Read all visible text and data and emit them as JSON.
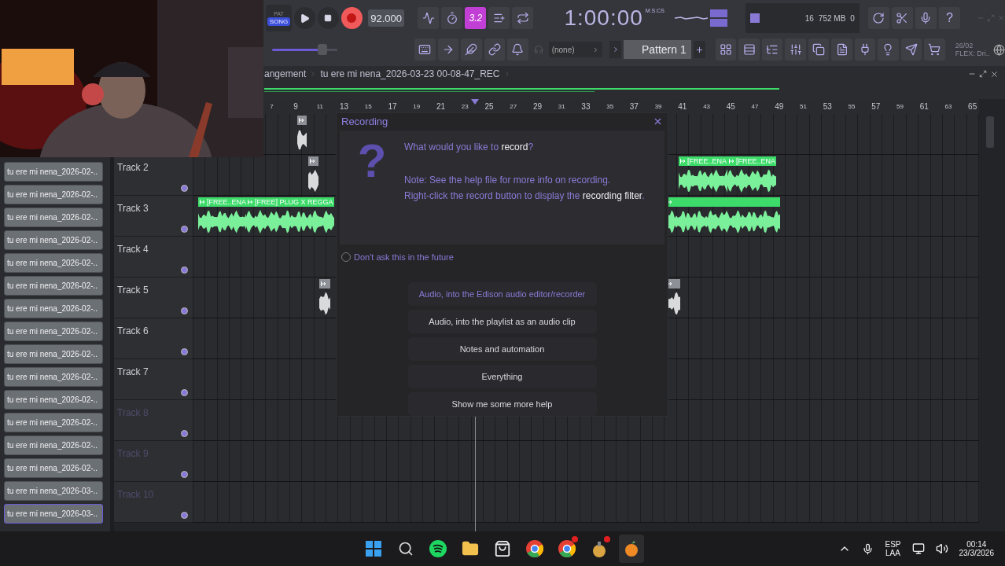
{
  "toolbar": {
    "mode_top": "PAT",
    "mode": "SONG",
    "song_mode": true,
    "tempo": "92.000",
    "snap": "3.2",
    "time": "1:00:00",
    "time_unit": "M:S:CS",
    "cpu": "16",
    "memory": "752 MB",
    "polyphony": "0",
    "help": "?",
    "master_volume": {
      "level": 0.77
    },
    "channel_select": "(none)",
    "pattern": "Pattern 1",
    "info": [
      "26/02",
      "FLEX: Dri.."
    ]
  },
  "breadcrumb": [
    "angement",
    "tu ere mi nena_2026-03-23 00-08-47_REC"
  ],
  "browser": [
    {
      "label": "tu ere mi nena_2026-02-..",
      "selected": false
    },
    {
      "label": "tu ere mi nena_2026-02-..",
      "selected": false
    },
    {
      "label": "tu ere mi nena_2026-02-..",
      "selected": false
    },
    {
      "label": "tu ere mi nena_2026-02-..",
      "selected": false
    },
    {
      "label": "tu ere mi nena_2026-02-..",
      "selected": false
    },
    {
      "label": "tu ere mi nena_2026-02-..",
      "selected": false
    },
    {
      "label": "tu ere mi nena_2026-02-..",
      "selected": false
    },
    {
      "label": "tu ere mi nena_2026-02-..",
      "selected": false
    },
    {
      "label": "tu ere mi nena_2026-02-..",
      "selected": false
    },
    {
      "label": "tu ere mi nena_2026-02-..",
      "selected": false
    },
    {
      "label": "tu ere mi nena_2026-02-..",
      "selected": false
    },
    {
      "label": "tu ere mi nena_2026-02-..",
      "selected": false
    },
    {
      "label": "tu ere mi nena_2026-02-..",
      "selected": false
    },
    {
      "label": "tu ere mi nena_2026-02-..",
      "selected": false
    },
    {
      "label": "tu ere mi nena_2026-03-..",
      "selected": false
    },
    {
      "label": "tu ere mi nena_2026-03-..",
      "selected": true
    }
  ],
  "ruler": [
    "7",
    "9",
    "11",
    "13",
    "15",
    "17",
    "19",
    "21",
    "23",
    "25",
    "27",
    "29",
    "31",
    "33",
    "35",
    "37",
    "39",
    "41",
    "43",
    "45",
    "47",
    "49",
    "51",
    "53",
    "55",
    "57",
    "59",
    "61",
    "63",
    "65"
  ],
  "tracks": [
    {
      "clips": [
        {
          "color": "#8d9197"
        }
      ]
    },
    {
      "name": "Track 2",
      "enabled": true,
      "clips": [
        {
          "color": "#8d9197"
        },
        {
          "color": "#3ddc6a",
          "label": "[FREE..ENA"
        },
        {
          "color": "#3ddc6a",
          "label": "[FREE..ENA"
        }
      ]
    },
    {
      "name": "Track 3",
      "enabled": true,
      "clips": [
        {
          "color": "#3ddc6a",
          "label": "[FREE..ENA"
        },
        {
          "color": "#3ddc6a",
          "label": "[FREE] PLUG X REGGA"
        },
        {
          "color": "#3ddc6a"
        }
      ]
    },
    {
      "name": "Track 4",
      "enabled": true
    },
    {
      "name": "Track 5",
      "enabled": true,
      "clips": [
        {
          "color": "#8d9197"
        },
        {
          "color": "#8d9197"
        }
      ]
    },
    {
      "name": "Track 6",
      "enabled": true
    },
    {
      "name": "Track 7",
      "enabled": true
    },
    {
      "name": "Track 8",
      "enabled": false
    },
    {
      "name": "Track 9",
      "enabled": false
    },
    {
      "name": "Track 10",
      "enabled": false
    }
  ],
  "dialog": {
    "title": "Recording",
    "icon": "?",
    "question": "What would you like to **record**?",
    "note": "Note: See the help file for more info on recording.",
    "hint": "Right-click the record button to display the **recording filter**.",
    "checkbox": {
      "label": "Don't ask this in the future",
      "checked": false
    },
    "options": [
      {
        "label": "Audio, into the Edison audio editor/recorder",
        "selected": true
      },
      {
        "label": "Audio, into the playlist as an audio clip",
        "selected": false
      },
      {
        "label": "Notes and automation",
        "selected": false
      },
      {
        "label": "Everything",
        "selected": false
      },
      {
        "label": "Show me some more help",
        "selected": false
      }
    ]
  },
  "taskbar": {
    "language": "ESP",
    "layout": "LAA",
    "time": "00:14",
    "date": "23/3/2026"
  }
}
